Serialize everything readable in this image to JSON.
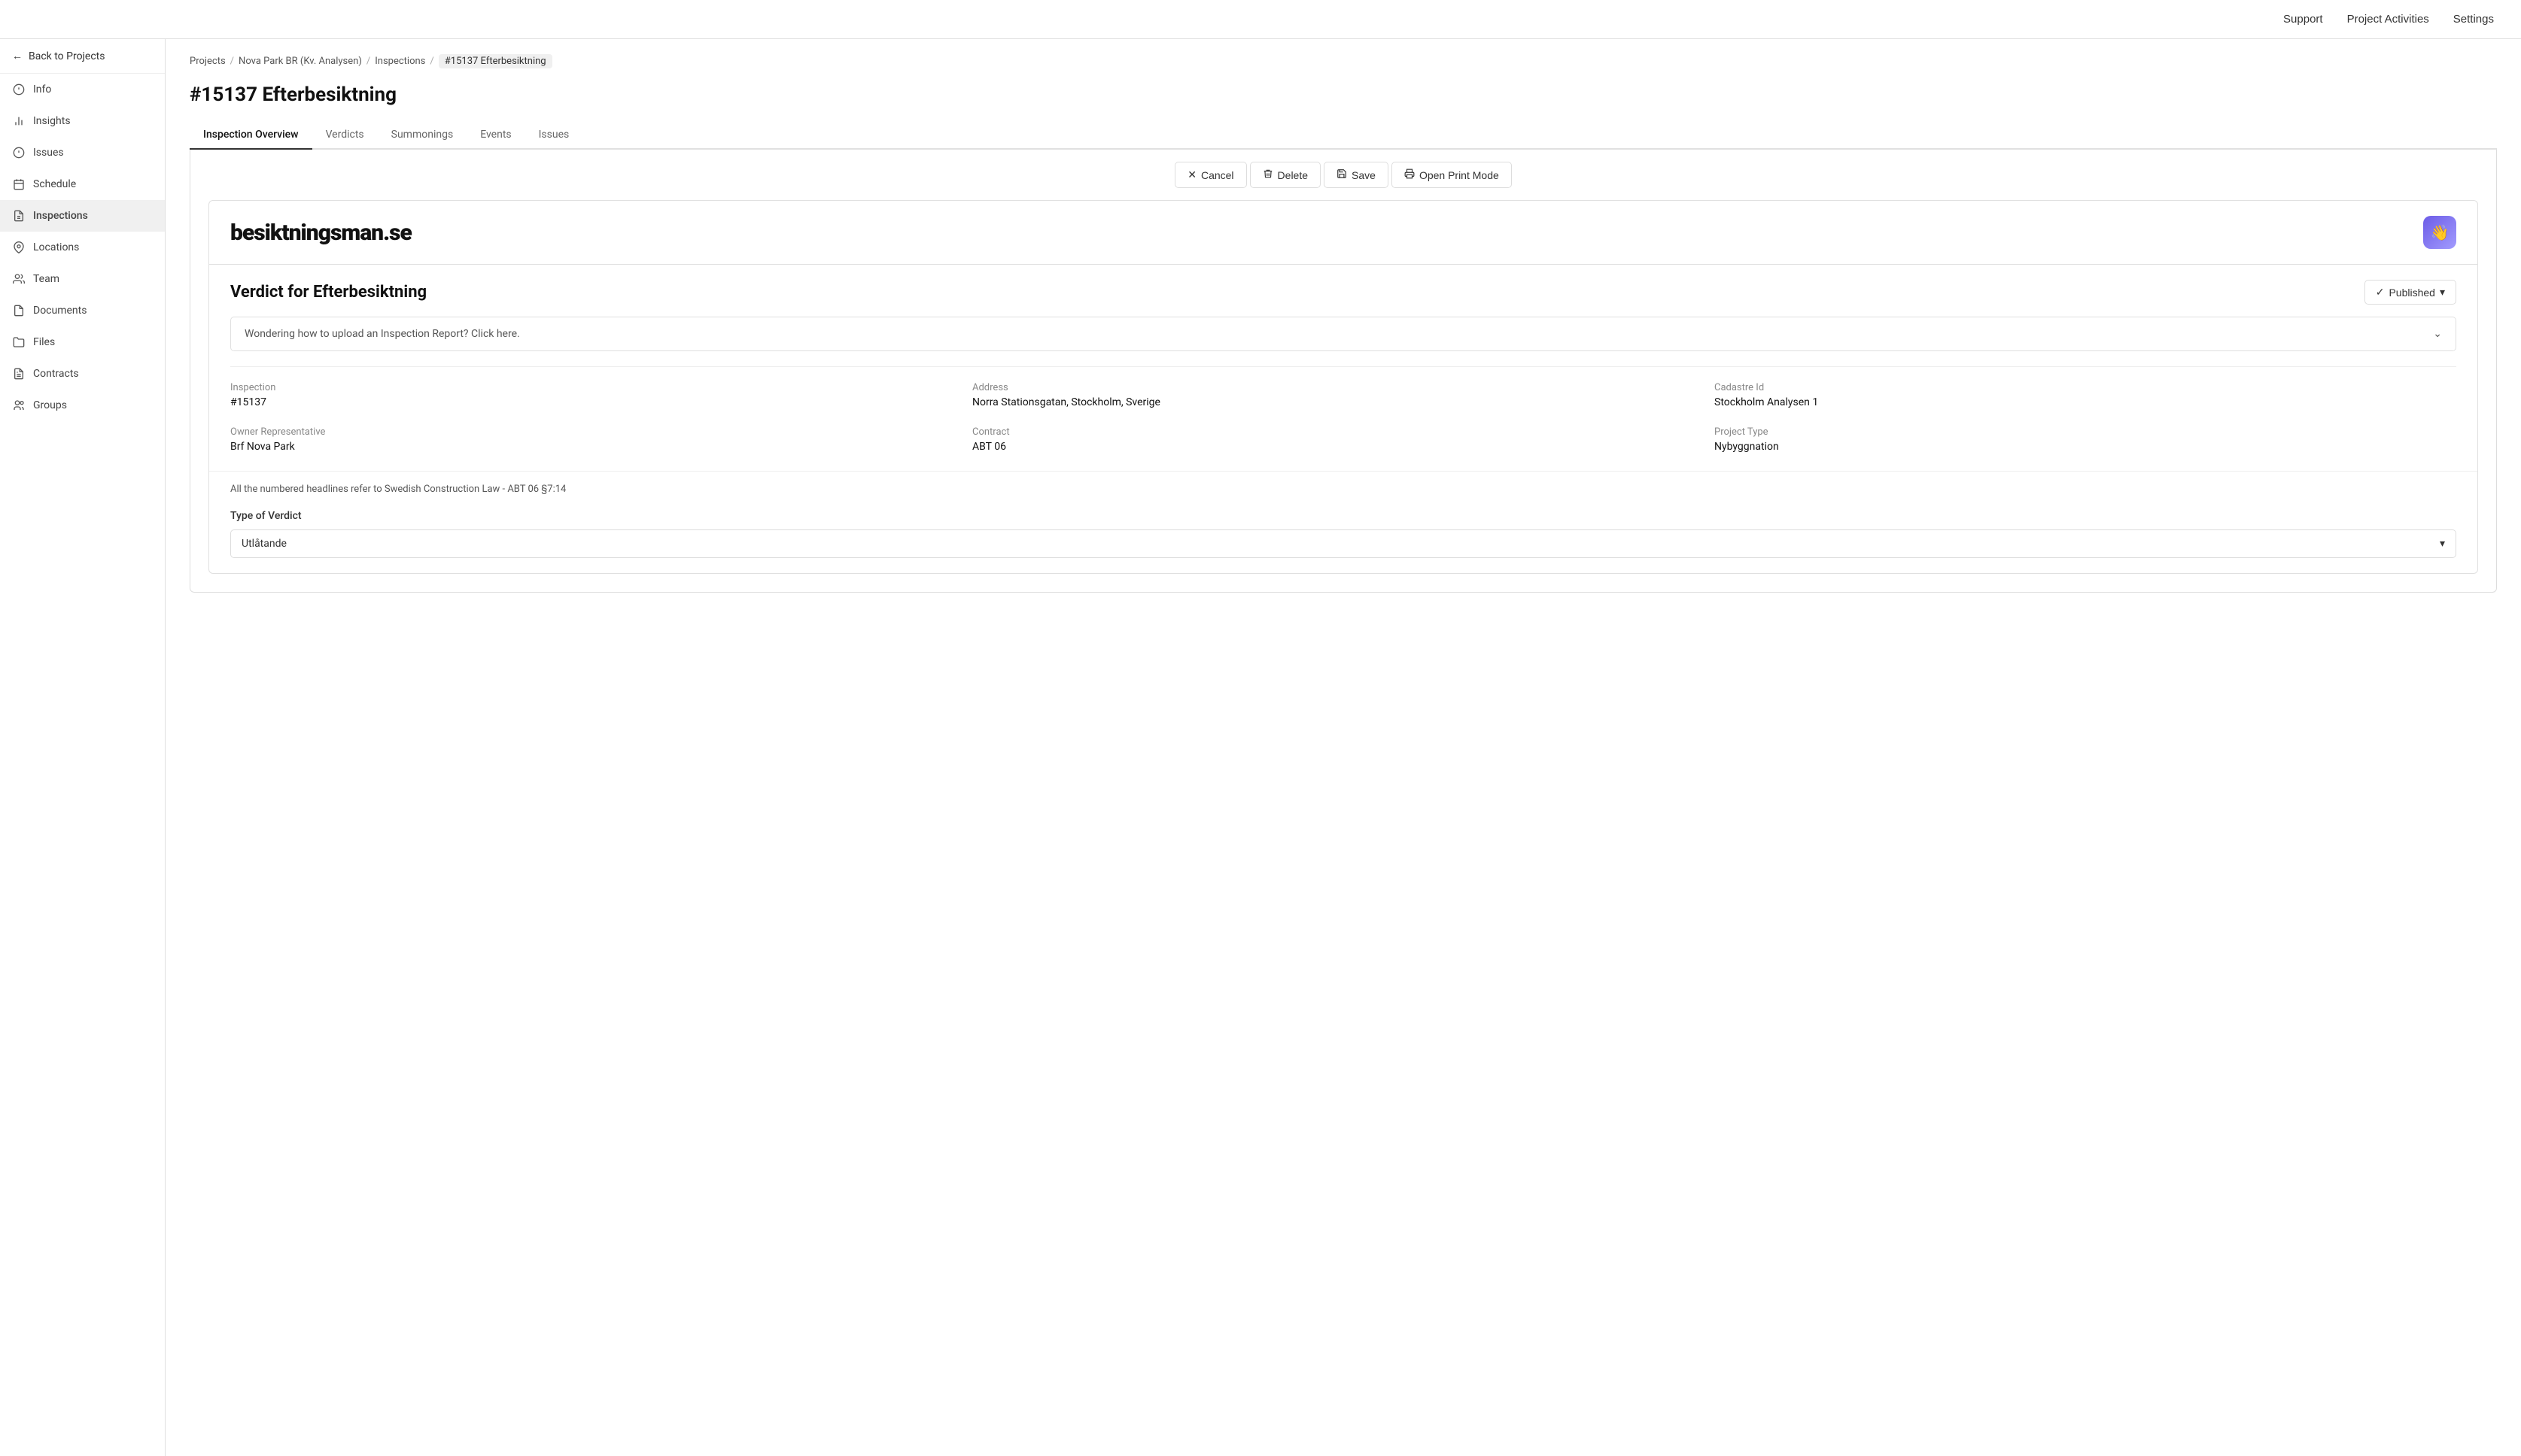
{
  "topNav": {
    "support": "Support",
    "projectActivities": "Project Activities",
    "settings": "Settings"
  },
  "sidebar": {
    "backLabel": "Back to Projects",
    "items": [
      {
        "id": "info",
        "label": "Info",
        "icon": "info-icon"
      },
      {
        "id": "insights",
        "label": "Insights",
        "icon": "chart-icon"
      },
      {
        "id": "issues",
        "label": "Issues",
        "icon": "issues-icon"
      },
      {
        "id": "schedule",
        "label": "Schedule",
        "icon": "schedule-icon"
      },
      {
        "id": "inspections",
        "label": "Inspections",
        "icon": "inspections-icon",
        "active": true
      },
      {
        "id": "locations",
        "label": "Locations",
        "icon": "locations-icon"
      },
      {
        "id": "team",
        "label": "Team",
        "icon": "team-icon"
      },
      {
        "id": "documents",
        "label": "Documents",
        "icon": "documents-icon"
      },
      {
        "id": "files",
        "label": "Files",
        "icon": "files-icon"
      },
      {
        "id": "contracts",
        "label": "Contracts",
        "icon": "contracts-icon"
      },
      {
        "id": "groups",
        "label": "Groups",
        "icon": "groups-icon"
      }
    ]
  },
  "breadcrumb": {
    "items": [
      "Projects",
      "Nova Park BR (Kv. Analysen)",
      "Inspections"
    ],
    "current": "#15137 Efterbesiktning"
  },
  "pageTitle": "#15137 Efterbesiktning",
  "tabs": [
    {
      "id": "inspection-overview",
      "label": "Inspection Overview",
      "active": true
    },
    {
      "id": "verdicts",
      "label": "Verdicts"
    },
    {
      "id": "summonings",
      "label": "Summonings"
    },
    {
      "id": "events",
      "label": "Events"
    },
    {
      "id": "issues",
      "label": "Issues"
    }
  ],
  "toolbar": {
    "cancelLabel": "Cancel",
    "deleteLabel": "Delete",
    "saveLabel": "Save",
    "printLabel": "Open Print Mode"
  },
  "document": {
    "logoText": "besiktningsman.se",
    "verdictTitle": "Verdict for Efterbesiktning",
    "publishedLabel": "Published",
    "infoBanner": "Wondering how to upload an Inspection Report? Click here.",
    "fields": {
      "inspection": {
        "label": "Inspection",
        "value": "#15137"
      },
      "address": {
        "label": "Address",
        "value": "Norra Stationsgatan, Stockholm, Sverige"
      },
      "cadastreId": {
        "label": "Cadastre Id",
        "value": "Stockholm Analysen 1"
      },
      "ownerRep": {
        "label": "Owner Representative",
        "value": "Brf Nova Park"
      },
      "contract": {
        "label": "Contract",
        "value": "ABT 06"
      },
      "projectType": {
        "label": "Project Type",
        "value": "Nybyggnation"
      }
    },
    "lawNote": "All the numbered headlines refer to Swedish Construction Law -   ABT 06   §7:14",
    "verdictTypeLabel": "Type of Verdict",
    "verdictTypeValue": "Utlåtande"
  }
}
